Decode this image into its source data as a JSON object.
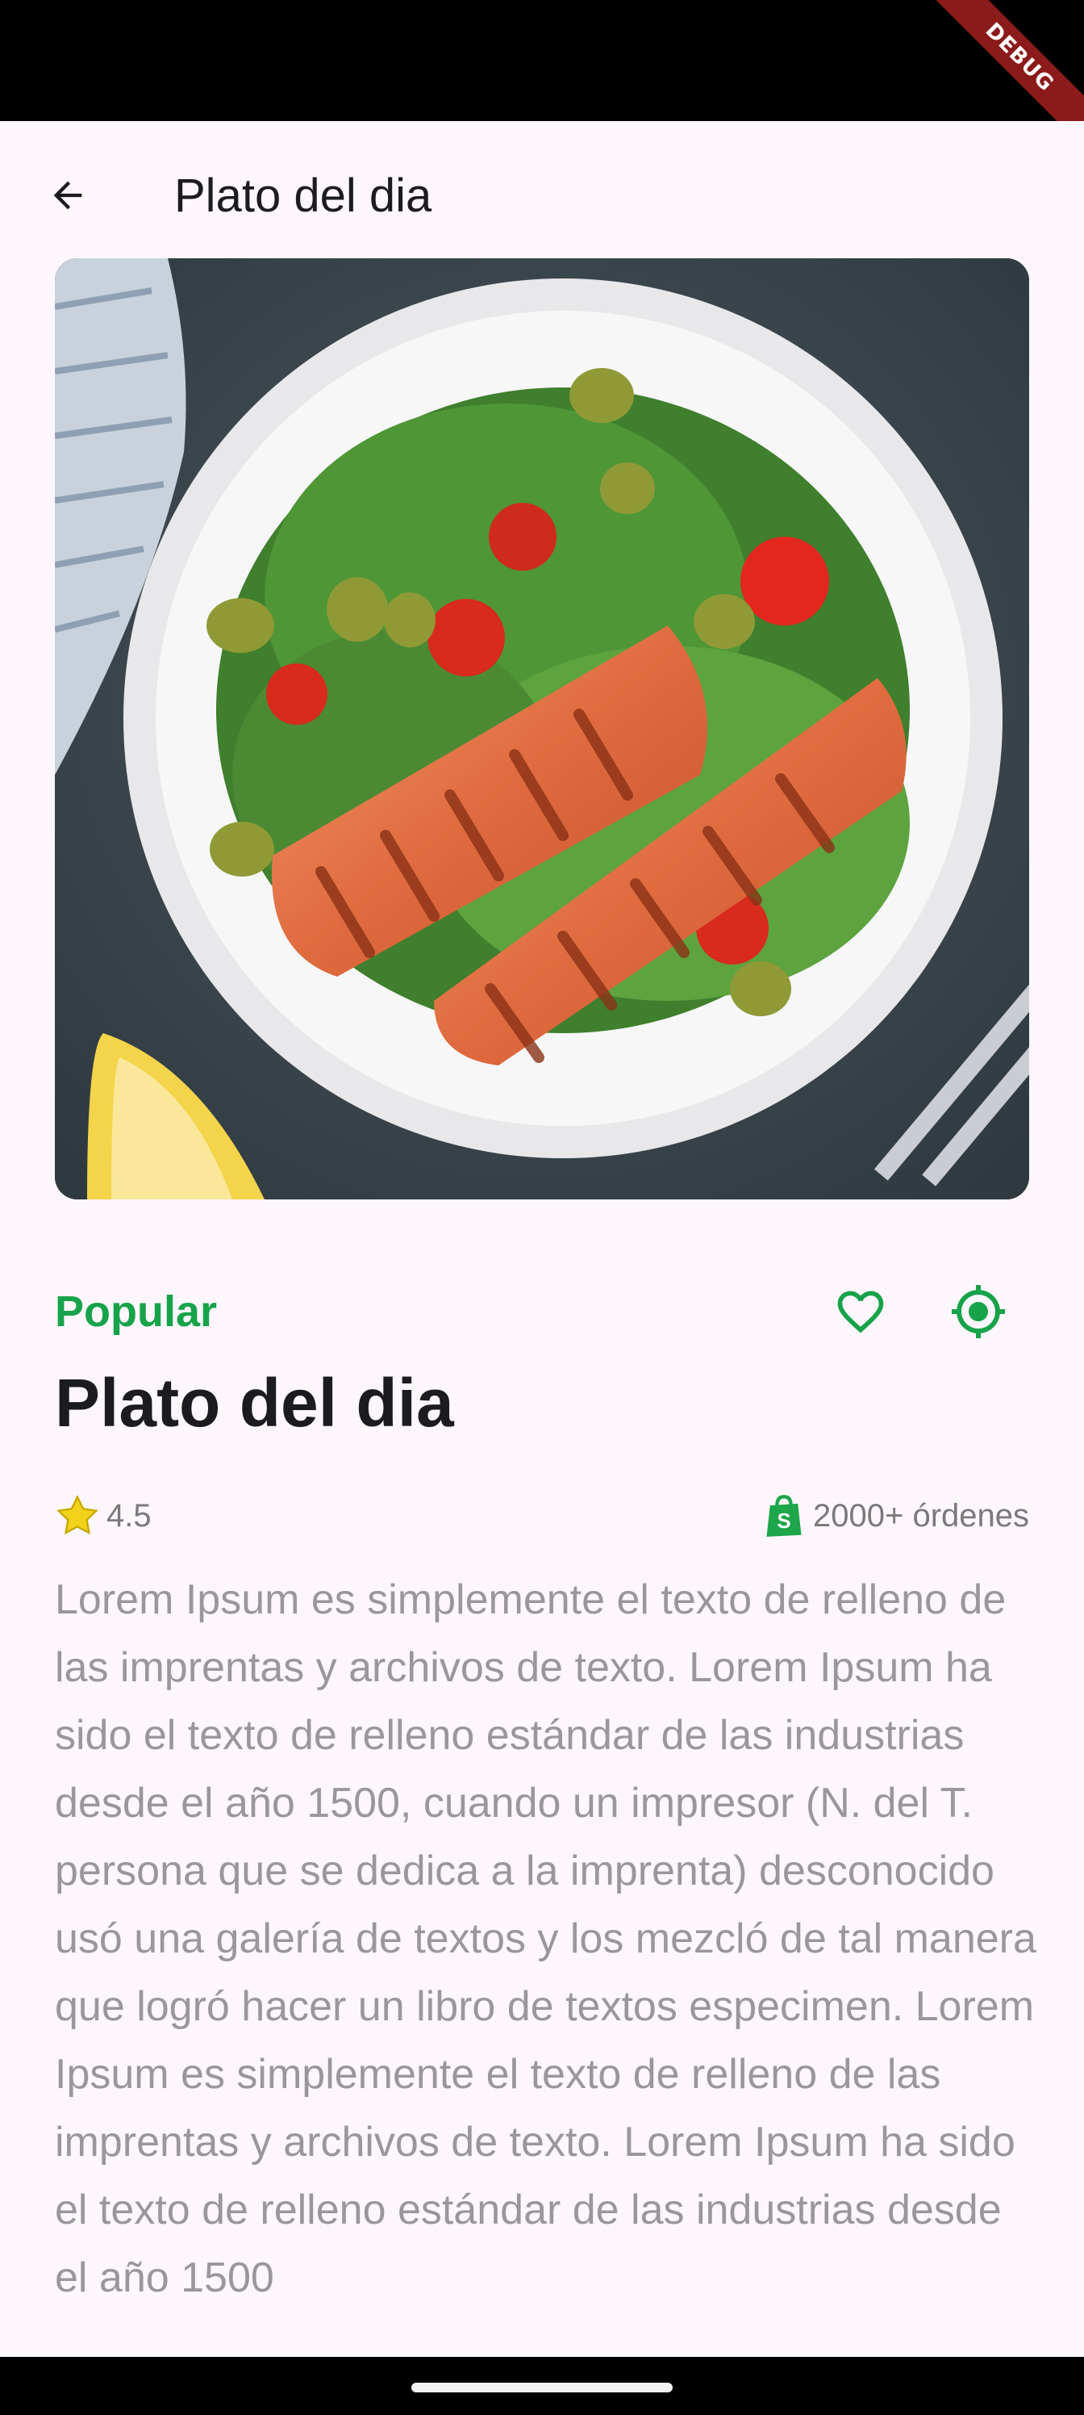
{
  "status_bar": {
    "debug_label": "DEBUG"
  },
  "app_bar": {
    "title": "Plato del dia",
    "back_icon": "arrow-left-icon"
  },
  "hero_image": {
    "alt": "salmon-salad-photo"
  },
  "info": {
    "tag": "Popular",
    "favorite_icon": "heart-outline-icon",
    "location_icon": "gps-fixed-icon",
    "accent_color": "#17a34a"
  },
  "dish": {
    "title": "Plato del dia"
  },
  "meta": {
    "rating_icon": "star-icon",
    "rating": "4.5",
    "orders_icon": "shopify-bag-icon",
    "orders": "2000+ órdenes"
  },
  "description": "Lorem Ipsum es simplemente el texto de relleno de las imprentas y archivos de texto. Lorem Ipsum ha sido el texto de relleno estándar de las industrias desde el año 1500, cuando un impresor (N. del T. persona que se dedica a la imprenta) desconocido usó una galería de textos y los mezcló de tal manera que logró hacer un libro de textos especimen. Lorem Ipsum es simplemente el texto de relleno de las imprentas y archivos de texto. Lorem Ipsum ha sido el texto de relleno estándar de las industrias desde el año 1500"
}
